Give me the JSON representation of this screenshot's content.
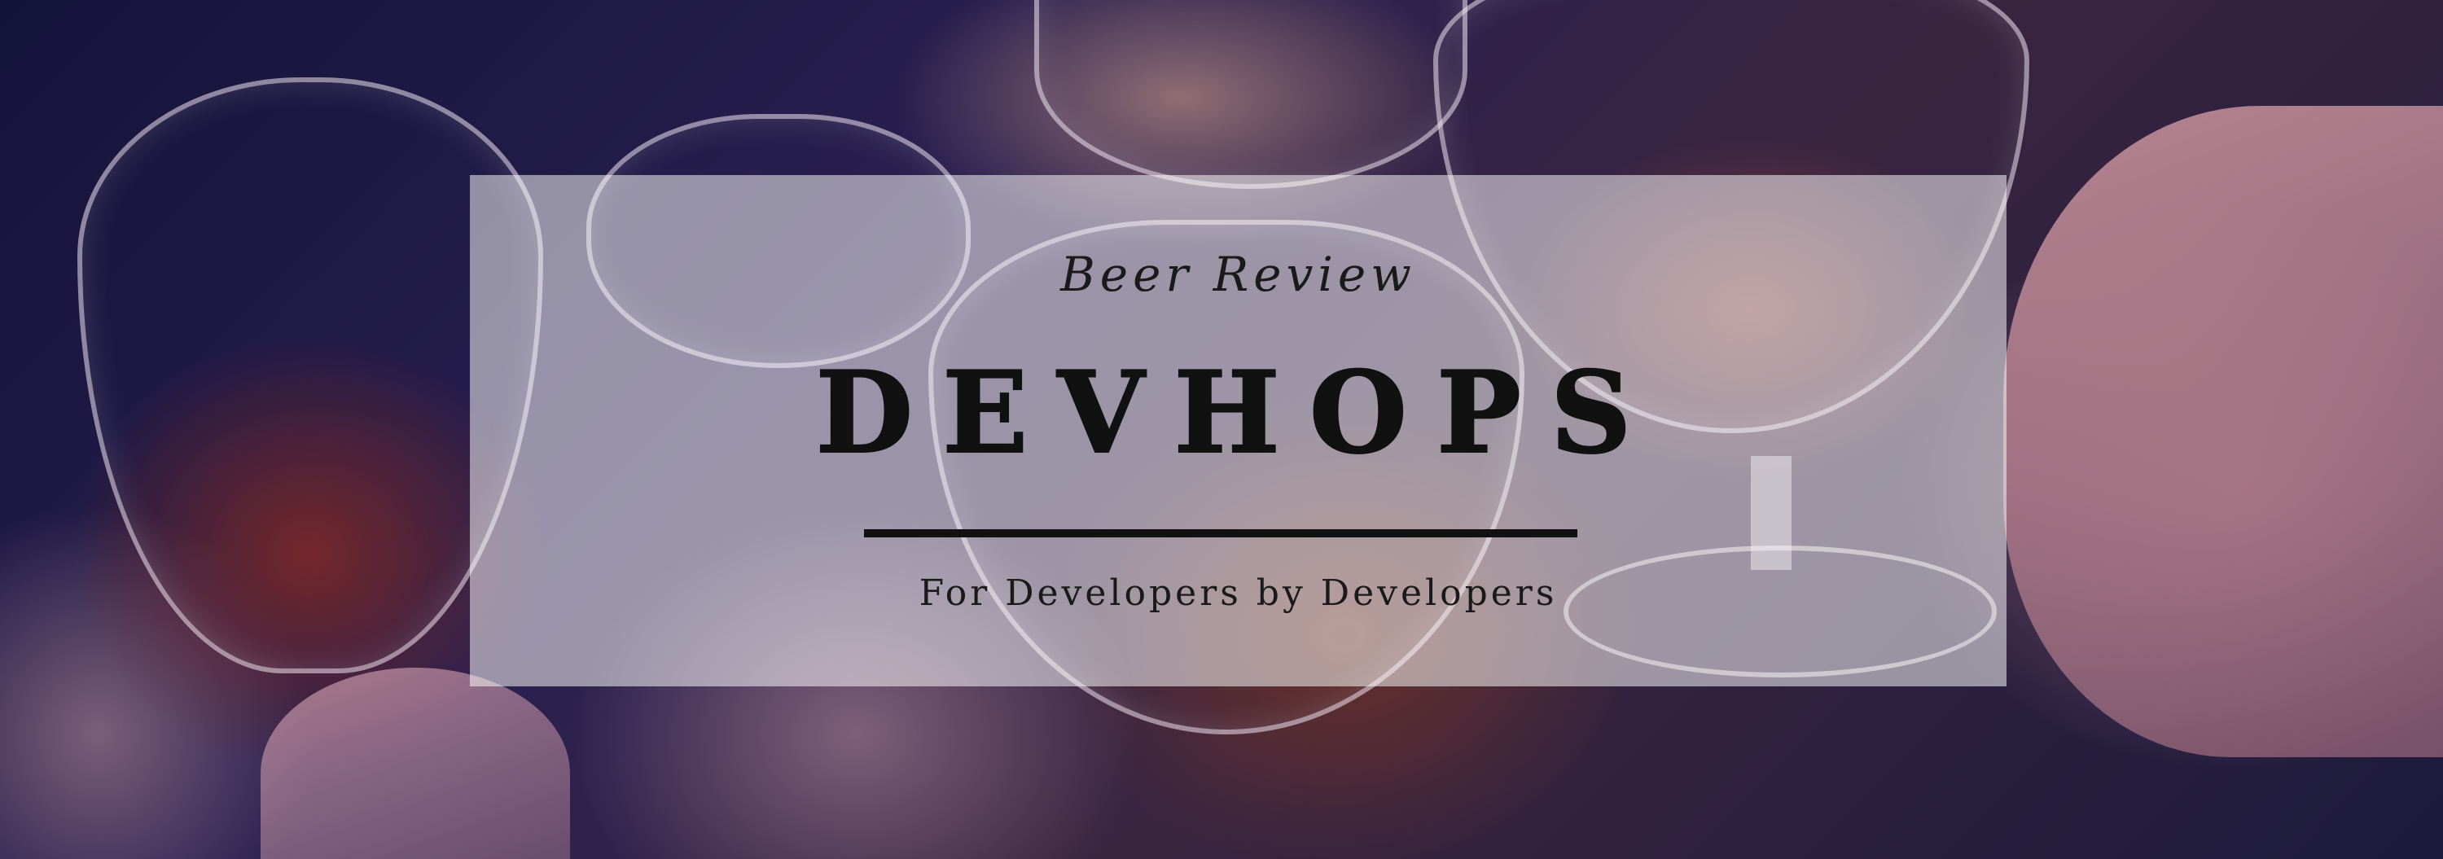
{
  "banner": {
    "kicker": "Beer Review",
    "title": "DEVHOPS",
    "tagline": "For Developers by Developers"
  },
  "colors": {
    "panel_overlay": "#FFFFFF",
    "text": "#111111",
    "background_dark": "#1a1833"
  }
}
